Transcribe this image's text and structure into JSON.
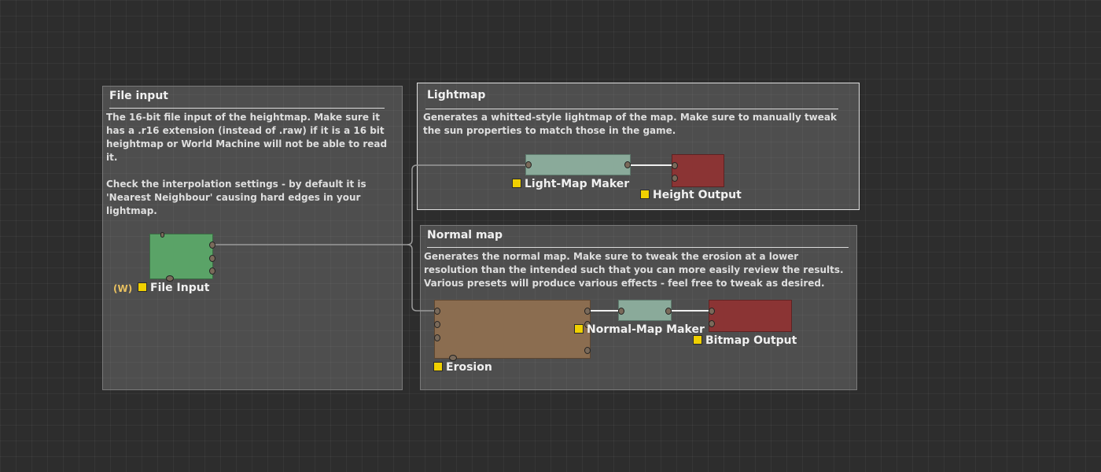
{
  "groups": {
    "file_input": {
      "title": "File input",
      "description": "The 16-bit file input of the heightmap. Make sure it has a .r16 extension (instead of .raw) if it is a 16 bit heightmap or World Machine will not be able to read it.\n\nCheck the interpolation settings - by default it is 'Nearest Neighbour' causing hard edges in your lightmap."
    },
    "lightmap": {
      "title": "Lightmap",
      "description": "Generates a whitted-style lightmap of the map. Make sure to manually tweak the sun properties to match those in the game."
    },
    "normal_map": {
      "title": "Normal map",
      "description": "Generates the normal map. Make sure to tweak the erosion at a lower resolution than the intended such that you can more easily review the results. Various presets will produce various effects - feel free to tweak as desired."
    }
  },
  "nodes": {
    "file_input": {
      "label": "File Input",
      "badge": "(W)"
    },
    "light_map_maker": {
      "label": "Light-Map Maker"
    },
    "height_output": {
      "label": "Height Output"
    },
    "erosion": {
      "label": "Erosion"
    },
    "normal_map_maker": {
      "label": "Normal-Map Maker"
    },
    "bitmap_output": {
      "label": "Bitmap Output"
    }
  },
  "colors": {
    "background": "#2d2d2d",
    "generator_node": "#5aa367",
    "filter_node": "#8aaa9a",
    "output_node": "#8b3434",
    "erosion_node": "#8b6d50",
    "selection_marker": "#f0d000"
  }
}
